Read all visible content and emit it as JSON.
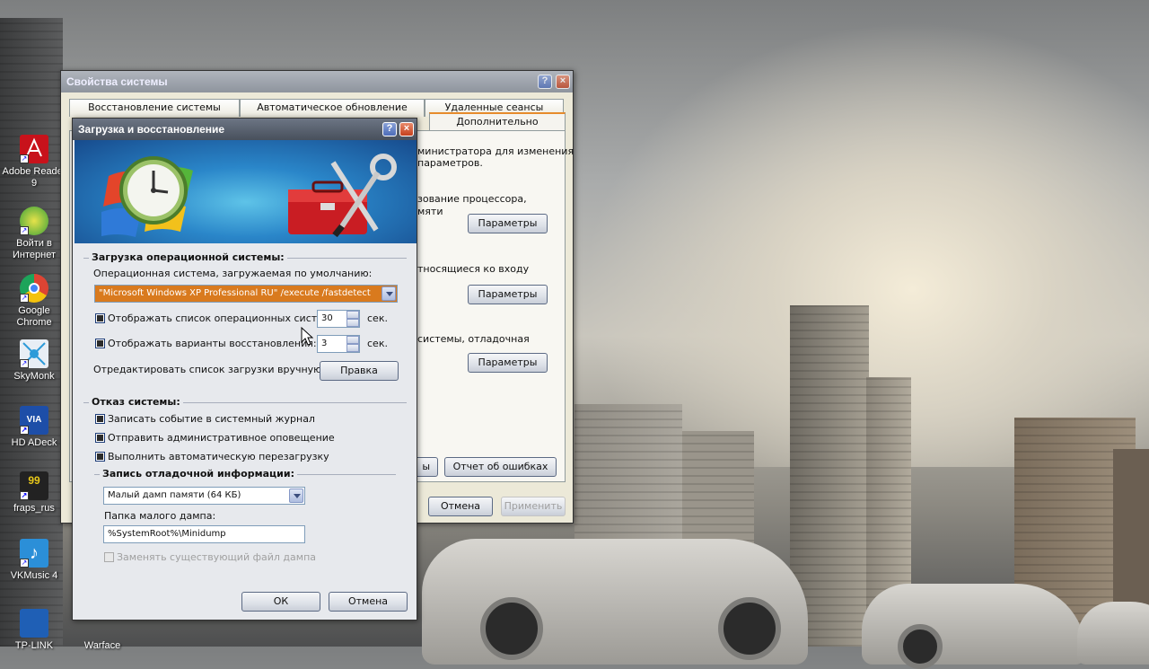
{
  "desktop": {
    "icons": [
      {
        "label": "Adobe Reader 9",
        "color": "#c8121b"
      },
      {
        "label": "Войти в Интернет",
        "color": "#3aa13a"
      },
      {
        "label": "Google Chrome",
        "color": "#dd4433"
      },
      {
        "label": "SkyMonk",
        "color": "#2d9bd9"
      },
      {
        "label": "HD ADeck",
        "color": "#1d4ea8"
      },
      {
        "label": "fraps_rus",
        "color": "#e8c81a"
      },
      {
        "label": "VKMusic 4",
        "color": "#2b8fd8"
      },
      {
        "label": "TP-LINK",
        "color": "#1f5fb5"
      },
      {
        "label": "Warface",
        "color": "#555555"
      }
    ]
  },
  "back_window": {
    "title": "Свойства системы",
    "tabs_row1": [
      "Восстановление системы",
      "Автоматическое обновление",
      "Удаленные сеансы"
    ],
    "tabs_row2_active": "Дополнительно",
    "text_admin": "министратора для изменения",
    "text_params": "параметров.",
    "text_perf1": "зование процессора,",
    "text_perf2": "мяти",
    "text_profiles": "тносящиеся ко входу",
    "text_startup": "системы, отладочная",
    "btn_params": "Параметры",
    "btn_error_report": "Отчет об ошибках",
    "btn_cancel": "Отмена",
    "btn_apply": "Применить",
    "btn_partial": "ы"
  },
  "dialog": {
    "title": "Загрузка и восстановление",
    "boot": {
      "group_title": "Загрузка операционной системы:",
      "default_os_label": "Операционная система, загружаемая по умолчанию:",
      "default_os_value": "\"Microsoft Windows XP Professional RU\" /execute /fastdetect",
      "show_os_list_label": "Отображать список операционных систем:",
      "show_os_list_value": "30",
      "show_recovery_label": "Отображать варианты восстановления:",
      "show_recovery_value": "3",
      "unit": "сек.",
      "edit_label": "Отредактировать список загрузки вручную:",
      "edit_button": "Правка"
    },
    "failure": {
      "group_title": "Отказ системы:",
      "write_event": "Записать событие в системный журнал",
      "send_alert": "Отправить административное оповещение",
      "auto_restart": "Выполнить автоматическую перезагрузку",
      "debug_title": "Запись отладочной информации:",
      "debug_type": "Малый дамп памяти (64 КБ)",
      "dump_folder_label": "Папка малого дампа:",
      "dump_folder_value": "%SystemRoot%\\Minidump",
      "overwrite_label": "Заменять существующий файл дампа"
    },
    "ok": "ОК",
    "cancel": "Отмена"
  }
}
